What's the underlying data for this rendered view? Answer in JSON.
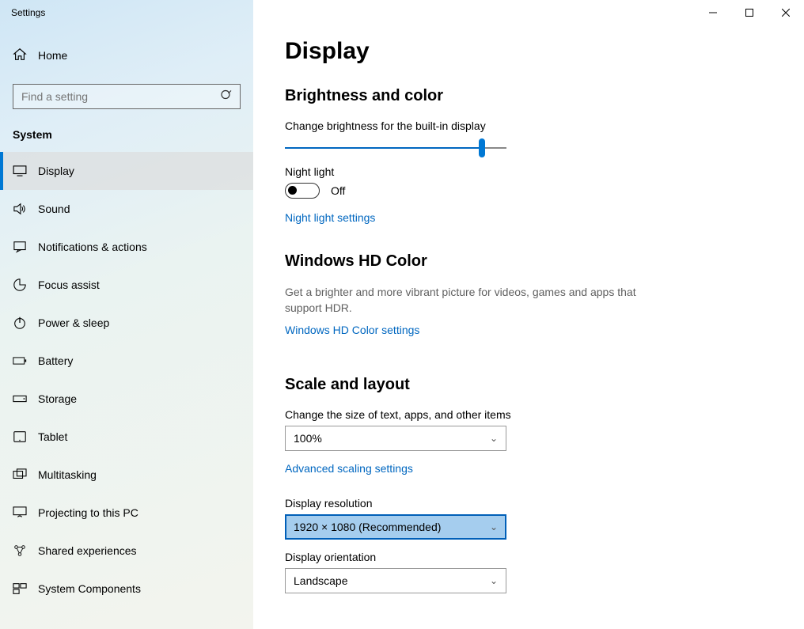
{
  "window": {
    "title": "Settings"
  },
  "sidebar": {
    "home": "Home",
    "search_placeholder": "Find a setting",
    "category": "System",
    "items": [
      {
        "label": "Display",
        "active": true
      },
      {
        "label": "Sound"
      },
      {
        "label": "Notifications & actions"
      },
      {
        "label": "Focus assist"
      },
      {
        "label": "Power & sleep"
      },
      {
        "label": "Battery"
      },
      {
        "label": "Storage"
      },
      {
        "label": "Tablet"
      },
      {
        "label": "Multitasking"
      },
      {
        "label": "Projecting to this PC"
      },
      {
        "label": "Shared experiences"
      },
      {
        "label": "System Components"
      }
    ]
  },
  "page": {
    "title": "Display",
    "brightness": {
      "heading": "Brightness and color",
      "label": "Change brightness for the built-in display",
      "value": 90,
      "nightlight_label": "Night light",
      "nightlight_state": "Off",
      "nightlight_link": "Night light settings"
    },
    "hdcolor": {
      "heading": "Windows HD Color",
      "desc": "Get a brighter and more vibrant picture for videos, games and apps that support HDR.",
      "link": "Windows HD Color settings"
    },
    "scale": {
      "heading": "Scale and layout",
      "size_label": "Change the size of text, apps, and other items",
      "size_value": "100%",
      "advanced_link": "Advanced scaling settings",
      "resolution_label": "Display resolution",
      "resolution_value": "1920 × 1080 (Recommended)",
      "orientation_label": "Display orientation",
      "orientation_value": "Landscape"
    }
  }
}
